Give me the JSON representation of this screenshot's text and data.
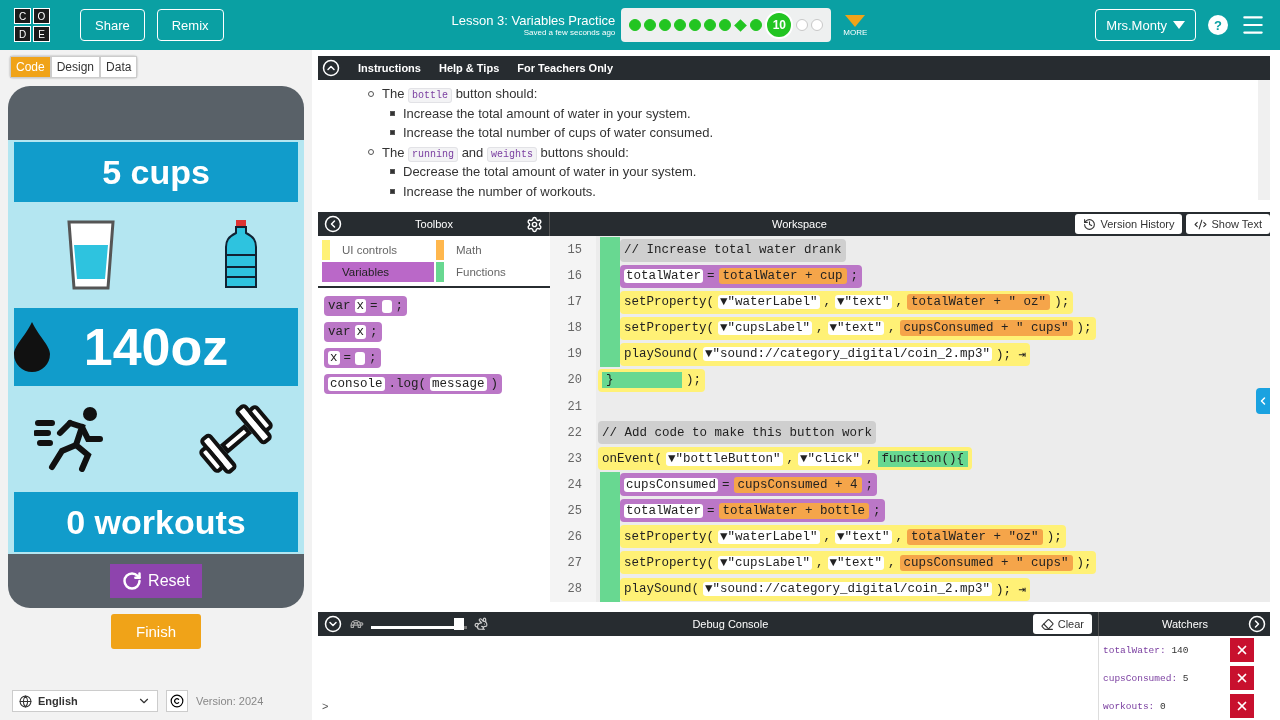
{
  "header": {
    "logo": [
      "C",
      "O",
      "D",
      "E"
    ],
    "buttons": [
      "Share",
      "Remix"
    ],
    "title": "Lesson 3: Variables Practice",
    "saved": "Saved a few seconds ago",
    "progress": [
      {
        "kind": "dot",
        "completed": true
      },
      {
        "kind": "dot",
        "completed": true
      },
      {
        "kind": "dot",
        "completed": true
      },
      {
        "kind": "dot",
        "completed": true
      },
      {
        "kind": "dot",
        "completed": true
      },
      {
        "kind": "dot",
        "completed": true
      },
      {
        "kind": "dot",
        "completed": true
      },
      {
        "kind": "diamond",
        "completed": true
      },
      {
        "kind": "dot",
        "completed": true
      },
      {
        "kind": "current",
        "completed": true,
        "label": "10"
      },
      {
        "kind": "dot",
        "completed": false
      },
      {
        "kind": "dot",
        "completed": false
      }
    ],
    "more": "MORE",
    "user": "Mrs.Monty",
    "help": "?"
  },
  "mode_tabs": [
    {
      "label": "Code",
      "selected": true
    },
    {
      "label": "Design",
      "selected": false
    },
    {
      "label": "Data",
      "selected": false
    }
  ],
  "app": {
    "cups_label": "5 cups",
    "water_label": "140oz",
    "workouts_label": "0 workouts",
    "reset": "Reset"
  },
  "finish": "Finish",
  "language": "English",
  "version": "Version: 2024",
  "instructions": {
    "tabs": [
      "Instructions",
      "Help & Tips",
      "For Teachers Only"
    ],
    "items": [
      {
        "segments": [
          {
            "kind": "text",
            "text": "The "
          },
          {
            "kind": "code",
            "text": "bottle"
          },
          {
            "kind": "text",
            "text": " button should:"
          }
        ],
        "children": [
          {
            "segments": [
              {
                "kind": "text",
                "text": "Increase the total amount of water in your system."
              }
            ]
          },
          {
            "segments": [
              {
                "kind": "text",
                "text": "Increase the total number of cups of water consumed."
              }
            ]
          }
        ]
      },
      {
        "segments": [
          {
            "kind": "text",
            "text": "The "
          },
          {
            "kind": "code",
            "text": "running"
          },
          {
            "kind": "text",
            "text": " and "
          },
          {
            "kind": "code",
            "text": "weights"
          },
          {
            "kind": "text",
            "text": " buttons should:"
          }
        ],
        "children": [
          {
            "segments": [
              {
                "kind": "text",
                "text": "Decrease the total amount of water in your system."
              }
            ]
          },
          {
            "segments": [
              {
                "kind": "text",
                "text": "Increase the number of workouts."
              }
            ]
          }
        ]
      }
    ]
  },
  "toolbox": {
    "title": "Toolbox",
    "categories": [
      {
        "label": "UI controls",
        "color": "#fff176",
        "selected": false
      },
      {
        "label": "Math",
        "color": "#ffb74d",
        "selected": false
      },
      {
        "label": "Variables",
        "color": "#ba68c8",
        "selected": true
      },
      {
        "label": "Functions",
        "color": "#68d891",
        "selected": false
      }
    ],
    "blocks": [
      {
        "segments": [
          {
            "kind": "plain",
            "text": "var"
          },
          {
            "kind": "field",
            "text": "x"
          },
          {
            "kind": "plain",
            "text": "="
          },
          {
            "kind": "slot"
          },
          {
            "kind": "plain",
            "text": ";"
          }
        ]
      },
      {
        "segments": [
          {
            "kind": "plain",
            "text": "var"
          },
          {
            "kind": "field",
            "text": "x"
          },
          {
            "kind": "plain",
            "text": ";"
          }
        ]
      },
      {
        "segments": [
          {
            "kind": "field",
            "text": "x"
          },
          {
            "kind": "plain",
            "text": "="
          },
          {
            "kind": "slot"
          },
          {
            "kind": "plain",
            "text": ";"
          }
        ]
      },
      {
        "segments": [
          {
            "kind": "field",
            "text": "console"
          },
          {
            "kind": "plain",
            "text": ".log("
          },
          {
            "kind": "field",
            "text": "message"
          },
          {
            "kind": "plain",
            "text": ")"
          }
        ]
      }
    ]
  },
  "workspace": {
    "title": "Workspace",
    "version_history": "Version History",
    "show_text": "Show Text",
    "code": [
      {
        "kind": "body",
        "children": [
          {
            "number": "15",
            "kind": "comment",
            "segments": [
              {
                "kind": "plain",
                "text": "// Increase total water drank"
              }
            ]
          },
          {
            "number": "16",
            "kind": "var",
            "segments": [
              {
                "kind": "field",
                "text": "totalWater"
              },
              {
                "kind": "plain",
                "text": "="
              },
              {
                "kind": "math",
                "text": "totalWater + cup"
              },
              {
                "kind": "plain",
                "text": ";"
              }
            ]
          },
          {
            "number": "17",
            "kind": "ui",
            "segments": [
              {
                "kind": "plain",
                "text": "setProperty("
              },
              {
                "kind": "field",
                "text": "▼\"waterLabel\""
              },
              {
                "kind": "plain",
                "text": ","
              },
              {
                "kind": "field",
                "text": "▼\"text\""
              },
              {
                "kind": "plain",
                "text": ","
              },
              {
                "kind": "math",
                "text": "totalWater + \" oz\""
              },
              {
                "kind": "plain",
                "text": ");"
              }
            ]
          },
          {
            "number": "18",
            "kind": "ui",
            "segments": [
              {
                "kind": "plain",
                "text": "setProperty("
              },
              {
                "kind": "field",
                "text": "▼\"cupsLabel\""
              },
              {
                "kind": "plain",
                "text": ","
              },
              {
                "kind": "field",
                "text": "▼\"text\""
              },
              {
                "kind": "plain",
                "text": ","
              },
              {
                "kind": "math",
                "text": "cupsConsumed + \" cups\""
              },
              {
                "kind": "plain",
                "text": ");"
              }
            ]
          },
          {
            "number": "19",
            "kind": "ui",
            "segments": [
              {
                "kind": "plain",
                "text": "playSound("
              },
              {
                "kind": "field",
                "text": "▼\"sound://category_digital/coin_2.mp3\""
              },
              {
                "kind": "plain",
                "text": "); ⇥"
              }
            ]
          }
        ]
      },
      {
        "number": "20",
        "kind": "close",
        "segments": [
          {
            "kind": "func",
            "text": "}"
          },
          {
            "kind": "plain",
            "text": ");"
          }
        ]
      },
      {
        "number": "21",
        "kind": "empty"
      },
      {
        "number": "22",
        "kind": "comment",
        "segments": [
          {
            "kind": "plain",
            "text": "// Add code to make this button work"
          }
        ]
      },
      {
        "number": "23",
        "kind": "event",
        "segments": [
          {
            "kind": "plain",
            "text": "onEvent("
          },
          {
            "kind": "field",
            "text": "▼\"bottleButton\""
          },
          {
            "kind": "plain",
            "text": ","
          },
          {
            "kind": "field",
            "text": "▼\"click\""
          },
          {
            "kind": "plain",
            "text": ","
          },
          {
            "kind": "func",
            "text": "function(){"
          }
        ],
        "children": [
          {
            "number": "24",
            "kind": "var",
            "segments": [
              {
                "kind": "field",
                "text": "cupsConsumed"
              },
              {
                "kind": "plain",
                "text": "="
              },
              {
                "kind": "math",
                "text": "cupsConsumed + 4"
              },
              {
                "kind": "plain",
                "text": ";"
              }
            ]
          },
          {
            "number": "25",
            "kind": "var",
            "segments": [
              {
                "kind": "field",
                "text": "totalWater"
              },
              {
                "kind": "plain",
                "text": "="
              },
              {
                "kind": "math",
                "text": "totalWater + bottle"
              },
              {
                "kind": "plain",
                "text": ";"
              }
            ]
          },
          {
            "number": "26",
            "kind": "ui",
            "segments": [
              {
                "kind": "plain",
                "text": "setProperty("
              },
              {
                "kind": "field",
                "text": "▼\"waterLabel\""
              },
              {
                "kind": "plain",
                "text": ","
              },
              {
                "kind": "field",
                "text": "▼\"text\""
              },
              {
                "kind": "plain",
                "text": ","
              },
              {
                "kind": "math",
                "text": "totalWater + \"oz\""
              },
              {
                "kind": "plain",
                "text": ");"
              }
            ]
          },
          {
            "number": "27",
            "kind": "ui",
            "segments": [
              {
                "kind": "plain",
                "text": "setProperty("
              },
              {
                "kind": "field",
                "text": "▼\"cupsLabel\""
              },
              {
                "kind": "plain",
                "text": ","
              },
              {
                "kind": "field",
                "text": "▼\"text\""
              },
              {
                "kind": "plain",
                "text": ","
              },
              {
                "kind": "math",
                "text": "cupsConsumed + \" cups\""
              },
              {
                "kind": "plain",
                "text": ");"
              }
            ]
          },
          {
            "number": "28",
            "kind": "ui",
            "segments": [
              {
                "kind": "plain",
                "text": "playSound("
              },
              {
                "kind": "field",
                "text": "▼\"sound://category_digital/coin_2.mp3\""
              },
              {
                "kind": "plain",
                "text": "); ⇥"
              }
            ]
          }
        ]
      }
    ]
  },
  "debug": {
    "title": "Debug Console",
    "clear": "Clear",
    "speed": {
      "level": 0.92
    },
    "prompt": ">"
  },
  "watchers": {
    "title": "Watchers",
    "items": [
      {
        "name": "totalWater:",
        "value": "140"
      },
      {
        "name": "cupsConsumed:",
        "value": "5"
      },
      {
        "name": "workouts:",
        "value": "0"
      }
    ]
  }
}
